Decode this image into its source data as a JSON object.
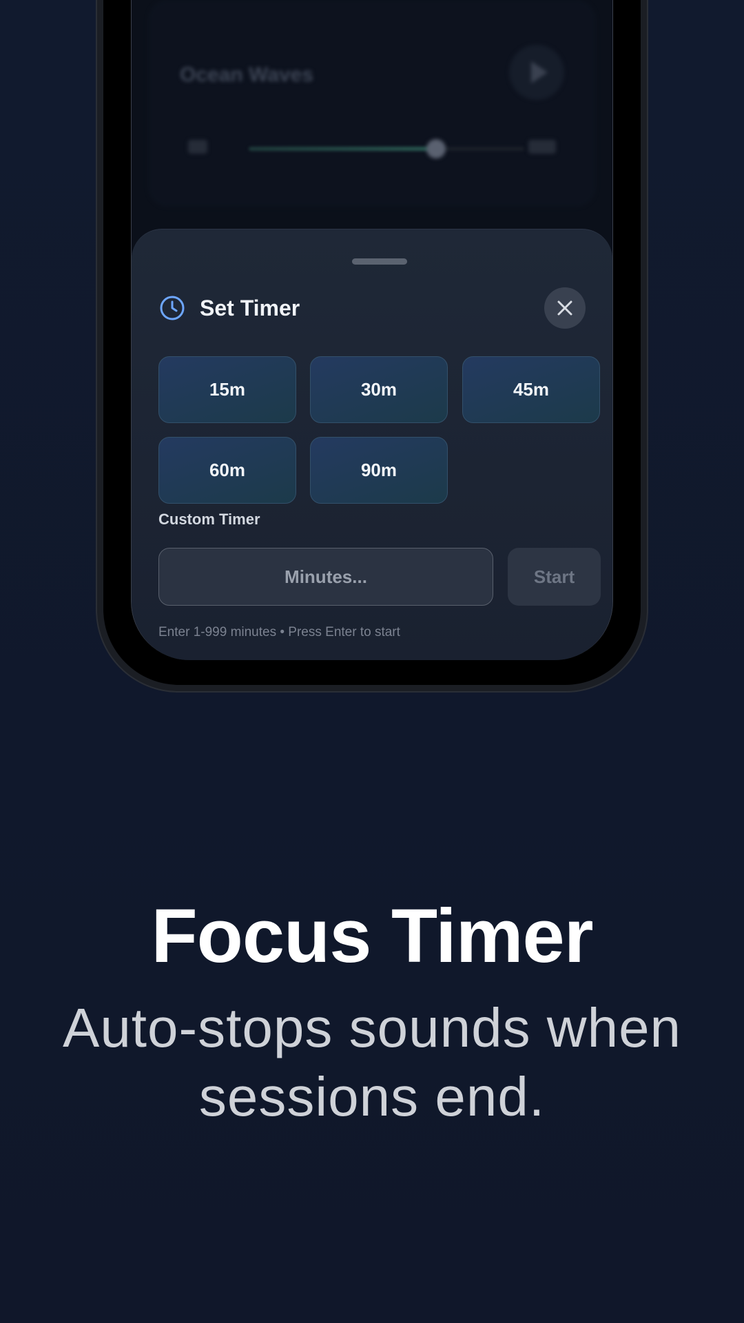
{
  "background_sound": {
    "title": "Ocean Waves",
    "volume_level": 0.68
  },
  "sheet": {
    "title": "Set Timer",
    "icon": "clock-icon",
    "close_icon": "close-icon",
    "presets": [
      "15m",
      "30m",
      "45m",
      "60m",
      "90m"
    ],
    "custom_label": "Custom Timer",
    "input_placeholder": "Minutes...",
    "start_label": "Start",
    "hint": "Enter 1-999 minutes • Press Enter to start"
  },
  "promo": {
    "title": "Focus Timer",
    "subtitle_line1": "Auto-stops sounds when",
    "subtitle_line2": "sessions end."
  },
  "colors": {
    "accent": "#6da6ff",
    "background": "#101729",
    "sheet": "#1d2533"
  }
}
